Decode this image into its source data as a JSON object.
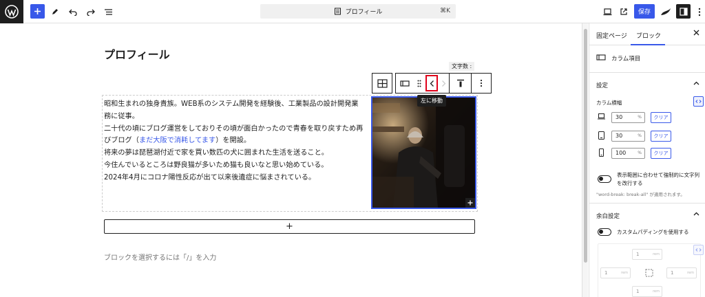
{
  "topbar": {
    "command": {
      "label": "プロフィール",
      "shortcut": "⌘K"
    },
    "save_label": "保存",
    "icons": [
      "wordpress-logo-icon",
      "plus-icon",
      "pen-icon",
      "undo-icon",
      "redo-icon",
      "list-view-icon",
      "desktop-preview-icon",
      "external-view-icon",
      "style-icon",
      "settings-icon",
      "more-icon"
    ]
  },
  "editor": {
    "title": "プロフィール",
    "word_count_label": "文字数 :",
    "tooltip": "左に移動",
    "paragraph": {
      "line1": "昭和生まれの独身貴族。WEB系のシステム開発を経験後、工業製品の設計開発業務に従事。",
      "line2_pre": "二十代の頃にブログ運営をしておりその頃が面白かったので青春を取り戻すため再びブログ（",
      "line2_link": "まだ大阪で消耗してます",
      "line2_post": "）を開設。",
      "line3": "将来の夢は琵琶湖付近で家を買い数匹の犬に囲まれた生活を送ること。",
      "line4": "今住んでいるところは野良猫が多いため猫も良いなと思い始めている。",
      "line5": "2024年4月にコロナ陽性反応が出て以来後遺症に悩まされている。"
    },
    "appender_symbol": "+",
    "placeholder": "ブロックを選択するには「/」を入力"
  },
  "sidebar": {
    "tabs": [
      {
        "label": "固定ページ"
      },
      {
        "label": "ブロック"
      }
    ],
    "block_name": "カラム項目",
    "settings_title": "設定",
    "column_width_label": "カラム横幅",
    "widths": [
      {
        "value": "30",
        "unit": "%",
        "clear": "クリア"
      },
      {
        "value": "30",
        "unit": "%",
        "clear": "クリア"
      },
      {
        "value": "100",
        "unit": "%",
        "clear": "クリア"
      }
    ],
    "wordbreak_label": "表示範囲に合わせて強制的に文字列を改行する",
    "wordbreak_note": "\"word-break: break-all\" が適用されます。",
    "spacing_title": "余白設定",
    "custom_padding_label": "カスタムパディングを使用する",
    "padding": {
      "top": "1",
      "left": "1",
      "right": "1",
      "bottom": "1",
      "unit": "rem"
    }
  },
  "colors": {
    "accent": "#3858e9",
    "dark": "#1e1e1e",
    "link": "#3858e9",
    "highlight": "#e0001a"
  }
}
